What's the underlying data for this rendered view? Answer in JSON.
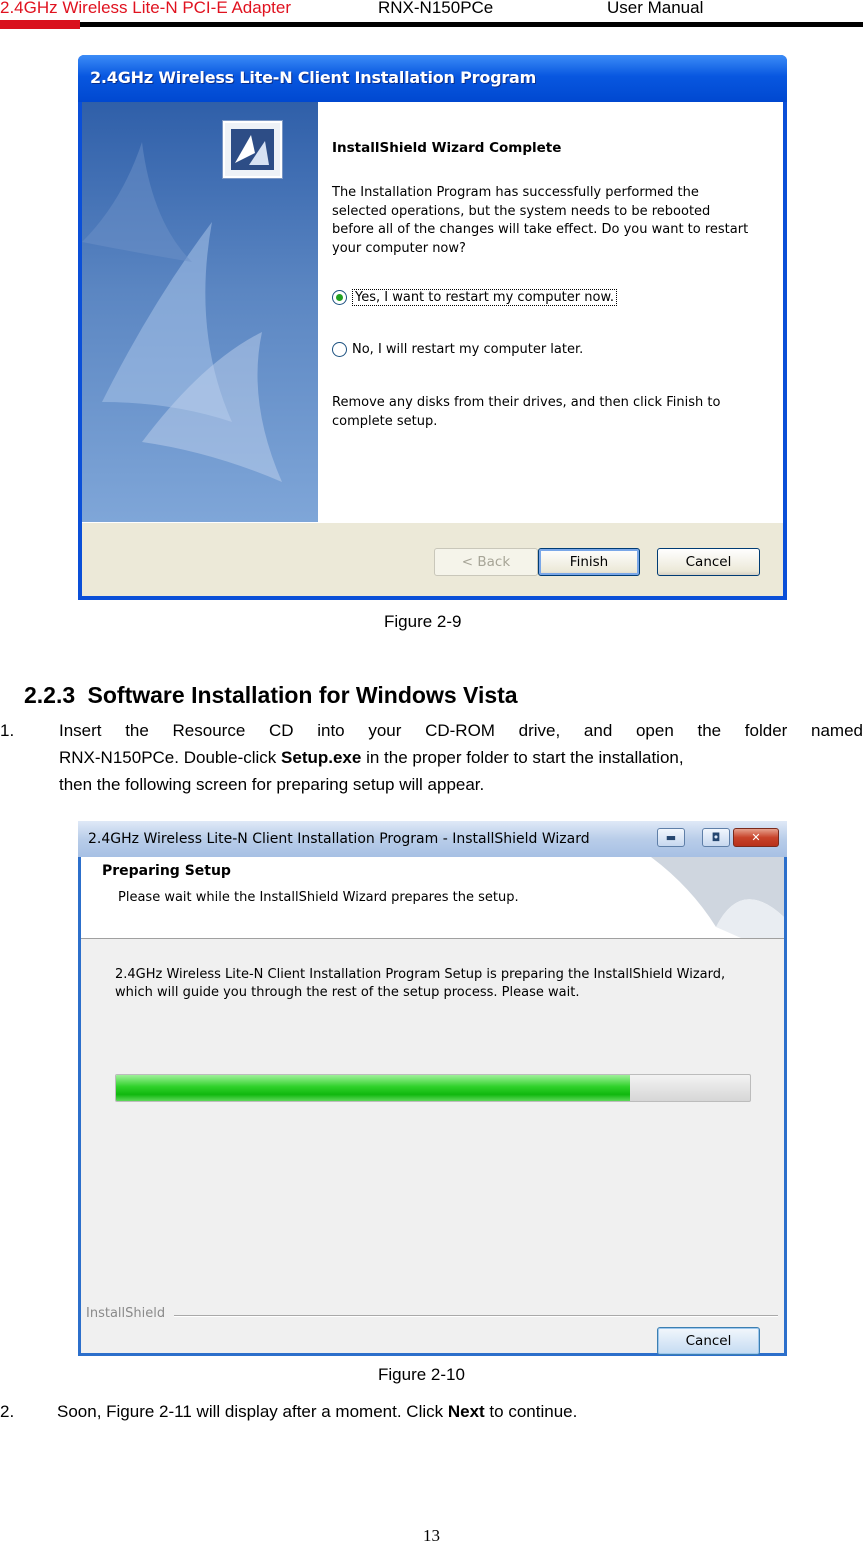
{
  "header": {
    "product": "2.4GHz Wireless Lite-N PCI-E Adapter",
    "model": "RNX-N150PCe",
    "manual": "User Manual"
  },
  "figure9": {
    "window_title": "2.4GHz Wireless Lite-N Client Installation Program",
    "heading": "InstallShield Wizard Complete",
    "message": "The Installation Program has successfully performed the selected operations, but the system needs to be rebooted before all of the changes will take effect. Do you want to restart your computer now?",
    "options": [
      {
        "label": "Yes, I want to restart my computer now.",
        "selected": true
      },
      {
        "label": "No, I will restart my computer later.",
        "selected": false
      }
    ],
    "remove_note": "Remove any disks from their drives, and then click Finish to complete setup.",
    "buttons": {
      "back": "< Back",
      "finish": "Finish",
      "cancel": "Cancel"
    },
    "caption": "Figure 2-9"
  },
  "section": {
    "number": "2.2.3",
    "title": "Software Installation for Windows Vista"
  },
  "step1": {
    "num": "1.",
    "line1": "Insert the Resource CD into your CD-ROM drive, and open the folder named",
    "line2_pre": "RNX-N150PCe. Double-click ",
    "line2_bold": "Setup.exe",
    "line2_post": " in the proper folder to start the installation,",
    "line3": "then the following screen for preparing setup will appear."
  },
  "figure10": {
    "window_title": "2.4GHz Wireless Lite-N Client Installation Program - InstallShield Wizard",
    "banner_heading": "Preparing Setup",
    "banner_sub": "Please wait while the InstallShield Wizard prepares the setup.",
    "body": "2.4GHz Wireless Lite-N Client Installation Program Setup is preparing the InstallShield Wizard, which will guide you through the rest of the setup process. Please wait.",
    "progress_percent": 81,
    "footer_brand": "InstallShield",
    "cancel": "Cancel",
    "caption": "Figure 2-10"
  },
  "step2": {
    "num": "2.",
    "pre": "Soon, Figure 2-11 will display after a moment. Click ",
    "bold": "Next",
    "post": " to continue."
  },
  "page_number": "13",
  "colors": {
    "header_red": "#e0121f",
    "progress_green": "#10b80e",
    "xp_title_blue": "#0857e0"
  }
}
